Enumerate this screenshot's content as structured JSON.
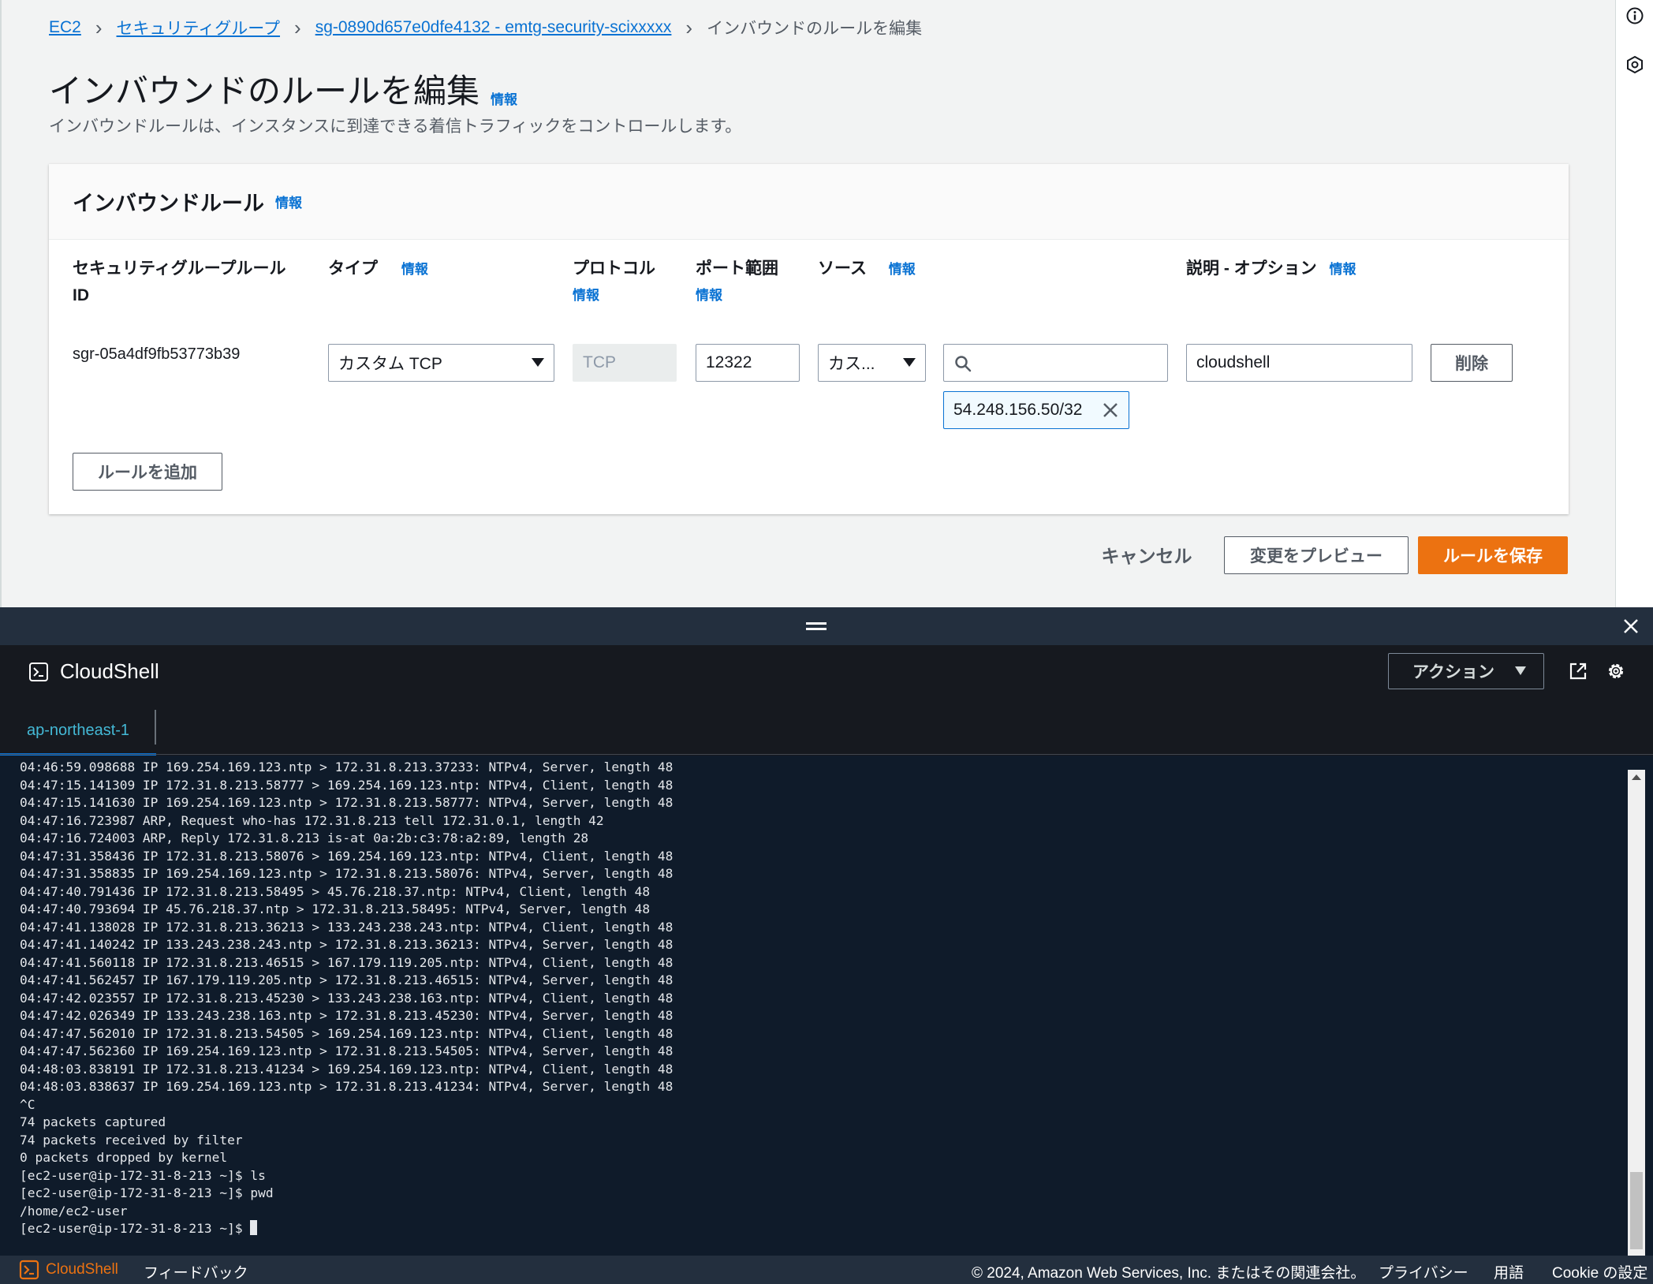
{
  "breadcrumb": {
    "items": [
      "EC2",
      "セキュリティグループ",
      "sg-0890d657e0dfe4132 - emtg-security-scixxxxx"
    ],
    "current": "インバウンドのルールを編集"
  },
  "page": {
    "title": "インバウンドのルールを編集",
    "info": "情報",
    "description": "インバウンドルールは、インスタンスに到達できる着信トラフィックをコントロールします。"
  },
  "panel": {
    "title": "インバウンドルール",
    "info": "情報",
    "columns": {
      "rule_id_line1": "セキュリティグループルール",
      "rule_id_line2": "ID",
      "type": "タイプ",
      "protocol": "プロトコル",
      "port_range": "ポート範囲",
      "source": "ソース",
      "description": "説明 - オプション",
      "info": "情報"
    },
    "rule": {
      "id": "sgr-05a4df9fb53773b39",
      "type": "カスタム TCP",
      "protocol": "TCP",
      "port": "12322",
      "source_type": "カス...",
      "source_search": "",
      "source_token": "54.248.156.50/32",
      "description": "cloudshell",
      "delete_label": "削除"
    },
    "add_rule_label": "ルールを追加"
  },
  "actions": {
    "cancel": "キャンセル",
    "preview": "変更をプレビュー",
    "save": "ルールを保存"
  },
  "cloudshell": {
    "title": "CloudShell",
    "actions_label": "アクション",
    "tab": "ap-northeast-1",
    "terminal_lines": [
      "04:46:59.098688 IP 169.254.169.123.ntp > 172.31.8.213.37233: NTPv4, Server, length 48",
      "04:47:15.141309 IP 172.31.8.213.58777 > 169.254.169.123.ntp: NTPv4, Client, length 48",
      "04:47:15.141630 IP 169.254.169.123.ntp > 172.31.8.213.58777: NTPv4, Server, length 48",
      "04:47:16.723987 ARP, Request who-has 172.31.8.213 tell 172.31.0.1, length 42",
      "04:47:16.724003 ARP, Reply 172.31.8.213 is-at 0a:2b:c3:78:a2:89, length 28",
      "04:47:31.358436 IP 172.31.8.213.58076 > 169.254.169.123.ntp: NTPv4, Client, length 48",
      "04:47:31.358835 IP 169.254.169.123.ntp > 172.31.8.213.58076: NTPv4, Server, length 48",
      "04:47:40.791436 IP 172.31.8.213.58495 > 45.76.218.37.ntp: NTPv4, Client, length 48",
      "04:47:40.793694 IP 45.76.218.37.ntp > 172.31.8.213.58495: NTPv4, Server, length 48",
      "04:47:41.138028 IP 172.31.8.213.36213 > 133.243.238.243.ntp: NTPv4, Client, length 48",
      "04:47:41.140242 IP 133.243.238.243.ntp > 172.31.8.213.36213: NTPv4, Server, length 48",
      "04:47:41.560118 IP 172.31.8.213.46515 > 167.179.119.205.ntp: NTPv4, Client, length 48",
      "04:47:41.562457 IP 167.179.119.205.ntp > 172.31.8.213.46515: NTPv4, Server, length 48",
      "04:47:42.023557 IP 172.31.8.213.45230 > 133.243.238.163.ntp: NTPv4, Client, length 48",
      "04:47:42.026349 IP 133.243.238.163.ntp > 172.31.8.213.45230: NTPv4, Server, length 48",
      "04:47:47.562010 IP 172.31.8.213.54505 > 169.254.169.123.ntp: NTPv4, Client, length 48",
      "04:47:47.562360 IP 169.254.169.123.ntp > 172.31.8.213.54505: NTPv4, Server, length 48",
      "04:48:03.838191 IP 172.31.8.213.41234 > 169.254.169.123.ntp: NTPv4, Client, length 48",
      "04:48:03.838637 IP 169.254.169.123.ntp > 172.31.8.213.41234: NTPv4, Server, length 48",
      "^C",
      "74 packets captured",
      "74 packets received by filter",
      "0 packets dropped by kernel",
      "[ec2-user@ip-172-31-8-213 ~]$ ls",
      "[ec2-user@ip-172-31-8-213 ~]$ pwd",
      "/home/ec2-user"
    ],
    "prompt": "[ec2-user@ip-172-31-8-213 ~]$ "
  },
  "footer": {
    "cloudshell": "CloudShell",
    "feedback": "フィードバック",
    "copyright": "© 2024, Amazon Web Services, Inc. またはその関連会社。",
    "privacy": "プライバシー",
    "terms": "用語",
    "cookie": "Cookie の設定"
  },
  "colors": {
    "link": "#0972d3",
    "primary_button": "#ec7211",
    "shell_bg": "#0f1b2a",
    "header_dark": "#232f3e"
  },
  "icons": [
    "info-icon",
    "feedback-icon",
    "search-icon",
    "close-icon",
    "terminal-icon",
    "open-new-window-icon",
    "gear-icon"
  ]
}
